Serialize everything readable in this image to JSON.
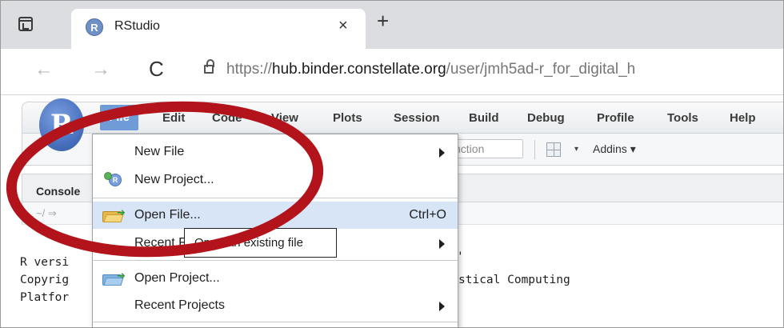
{
  "browser": {
    "tab_title": "RStudio",
    "tab_favicon": "R",
    "tab_close_icon": "×",
    "new_tab_icon": "+",
    "back_icon": "←",
    "forward_icon": "→",
    "reload_icon": "C",
    "url_scheme": "https://",
    "url_host": "hub.binder.constellate.org",
    "url_path": "/user/jmh5ad-r_for_digital_h"
  },
  "rstudio": {
    "logo_letter": "R",
    "menu": {
      "file": "File",
      "edit": "Edit",
      "code": "Code",
      "view": "View",
      "plots": "Plots",
      "session": "Session",
      "build": "Build",
      "debug": "Debug",
      "profile": "Profile",
      "tools": "Tools",
      "help": "Help"
    },
    "toolbar": {
      "goto_placeholder_visible": "nction",
      "addins_label": "Addins",
      "caret": "▾"
    },
    "pane": {
      "console_tab": "Console",
      "path_hint": "~/ ⇒"
    },
    "console_lines": [
      "R versi",
      "Copyrig",
      "Platfor"
    ],
    "console_fragments": {
      "quote_mark": "'",
      "stat_computing": "stical Computing"
    }
  },
  "file_menu": {
    "items": [
      {
        "label": "New File",
        "has_submenu": true
      },
      {
        "label": "New Project...",
        "icon": "new-project-icon"
      },
      {
        "label": "Open File...",
        "shortcut": "Ctrl+O",
        "highlighted": true,
        "icon": "open-folder-icon"
      },
      {
        "label": "Recent Files",
        "has_submenu": true
      },
      {
        "label": "Open Project...",
        "icon": "open-project-icon"
      },
      {
        "label": "Recent Projects",
        "has_submenu": true
      }
    ]
  },
  "tooltip": {
    "text": "Open an existing file"
  },
  "colors": {
    "annotation_red": "#b3141b",
    "menu_file_active": "#6f9bd9",
    "menu_highlight": "#d7e5f6"
  }
}
